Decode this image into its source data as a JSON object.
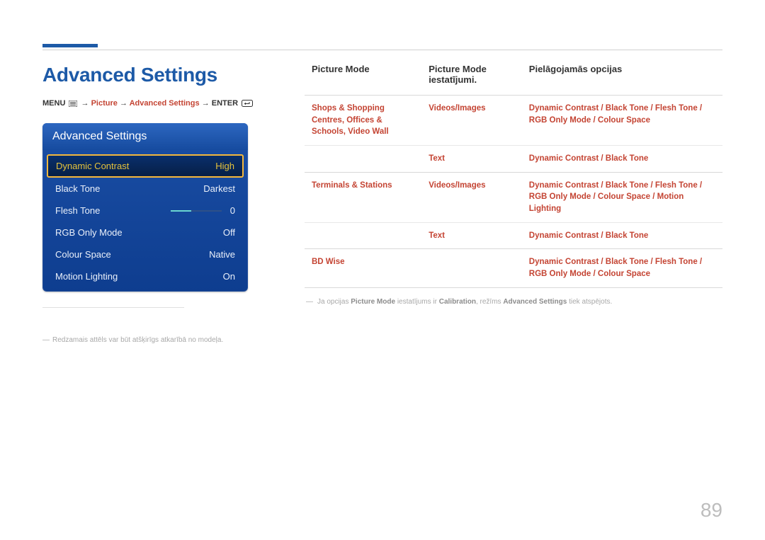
{
  "pageNumber": "89",
  "title": "Advanced Settings",
  "breadcrumb": {
    "menu": "MENU",
    "arrow": "→",
    "picture": "Picture",
    "advanced": "Advanced Settings",
    "enter": "ENTER"
  },
  "panel": {
    "header": "Advanced Settings",
    "items": [
      {
        "label": "Dynamic Contrast",
        "value": "High",
        "selected": true
      },
      {
        "label": "Black Tone",
        "value": "Darkest",
        "selected": false
      },
      {
        "label": "Flesh Tone",
        "value": "0",
        "selected": false,
        "slider": true
      },
      {
        "label": "RGB Only Mode",
        "value": "Off",
        "selected": false
      },
      {
        "label": "Colour Space",
        "value": "Native",
        "selected": false
      },
      {
        "label": "Motion Lighting",
        "value": "On",
        "selected": false
      }
    ]
  },
  "leftFootnote": "Redzamais attēls var būt atšķirīgs atkarībā no modeļa.",
  "table": {
    "headers": [
      "Picture Mode",
      "Picture Mode iestatījumi.",
      "Pielāgojamās opcijas"
    ],
    "rows": [
      {
        "c0": "Shops & Shopping Centres, Offices & Schools, Video Wall",
        "c1": "Videos/Images",
        "c2": "Dynamic Contrast / Black Tone / Flesh Tone / RGB Only Mode / Colour Space"
      },
      {
        "c0": "",
        "c1": "Text",
        "c2": "Dynamic Contrast / Black Tone",
        "groupEnd": true
      },
      {
        "c0": "Terminals & Stations",
        "c1": "Videos/Images",
        "c2": "Dynamic Contrast / Black Tone / Flesh Tone / RGB Only Mode / Colour Space / Motion Lighting"
      },
      {
        "c0": "",
        "c1": "Text",
        "c2": "Dynamic Contrast / Black Tone",
        "groupEnd": true
      },
      {
        "c0": "BD Wise",
        "c1": "",
        "c2": "Dynamic Contrast / Black Tone / Flesh Tone / RGB Only Mode / Colour Space",
        "groupEnd": true
      }
    ]
  },
  "footnote2": {
    "pre": "Ja opcijas ",
    "b1": "Picture Mode",
    "mid1": " iestatījums ir ",
    "b2": "Calibration",
    "mid2": ", režīms ",
    "b3": "Advanced Settings",
    "post": " tiek atspējots."
  }
}
